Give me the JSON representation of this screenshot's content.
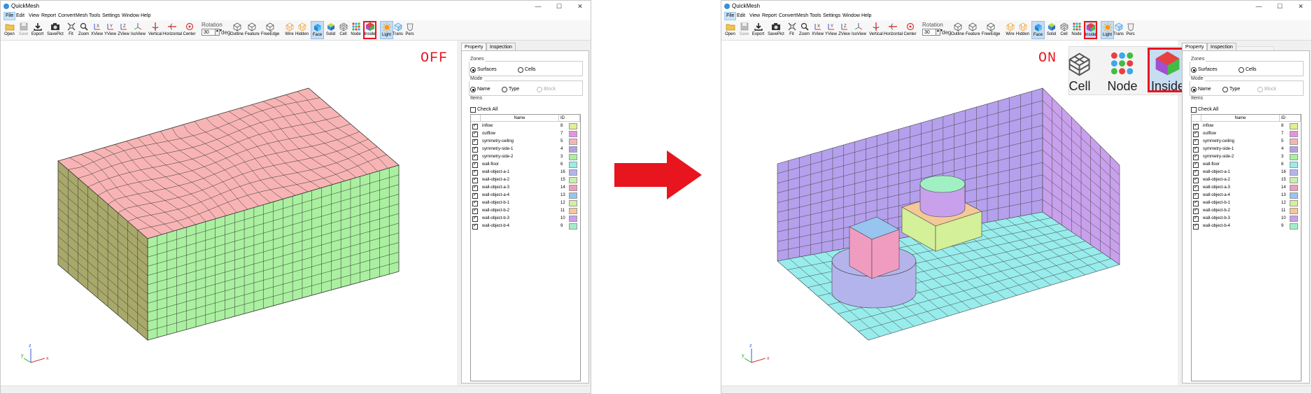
{
  "app": {
    "title": "QuickMesh",
    "minimize": "—",
    "maximize": "☐",
    "close": "✕"
  },
  "menu": [
    "File",
    "Edit",
    "View",
    "Report",
    "Convert",
    "Mesh",
    "Tools",
    "Settings",
    "Window",
    "Help"
  ],
  "toolbar": {
    "buttons": [
      {
        "id": "open",
        "label": "Open",
        "icon": "folder-icon"
      },
      {
        "id": "save",
        "label": "Save",
        "icon": "save-icon"
      },
      {
        "id": "export",
        "label": "Export",
        "icon": "export-icon"
      },
      {
        "id": "savepict",
        "label": "SavePict",
        "icon": "camera-icon"
      },
      {
        "id": "fit",
        "label": "Fit",
        "icon": "fit-icon"
      },
      {
        "id": "zoom",
        "label": "Zoom",
        "icon": "zoom-icon"
      },
      {
        "id": "xview",
        "label": "XView",
        "icon": "xview-icon"
      },
      {
        "id": "yview",
        "label": "YView",
        "icon": "yview-icon"
      },
      {
        "id": "zview",
        "label": "ZView",
        "icon": "zview-icon"
      },
      {
        "id": "isoview",
        "label": "IsoView",
        "icon": "isoview-icon"
      },
      {
        "id": "vertical",
        "label": "Vertical",
        "icon": "vertical-icon"
      },
      {
        "id": "horizontal",
        "label": "Horizontal",
        "icon": "horizontal-icon"
      },
      {
        "id": "center",
        "label": "Center",
        "icon": "center-icon"
      },
      {
        "id": "outline",
        "label": "Outline",
        "icon": "outline-icon"
      },
      {
        "id": "feature",
        "label": "Feature",
        "icon": "feature-icon"
      },
      {
        "id": "freeedge",
        "label": "FreeEdge",
        "icon": "freeedge-icon"
      },
      {
        "id": "wire",
        "label": "Wire",
        "icon": "wire-icon"
      },
      {
        "id": "hidden",
        "label": "Hidden",
        "icon": "hidden-icon"
      },
      {
        "id": "face",
        "label": "Face",
        "icon": "face-icon"
      },
      {
        "id": "solid",
        "label": "Solid",
        "icon": "solid-icon"
      },
      {
        "id": "cell",
        "label": "Cell",
        "icon": "cell-icon"
      },
      {
        "id": "node",
        "label": "Node",
        "icon": "node-icon"
      },
      {
        "id": "inside",
        "label": "Inside",
        "icon": "inside-icon"
      },
      {
        "id": "light",
        "label": "Light",
        "icon": "light-icon"
      },
      {
        "id": "trans",
        "label": "Trans",
        "icon": "trans-icon"
      },
      {
        "id": "pers",
        "label": "Pers",
        "icon": "pers-icon"
      }
    ],
    "rotation_label": "Rotation",
    "rotation_value": "30",
    "rotation_unit": "deg"
  },
  "panel": {
    "tabs": [
      "Property",
      "Inspection"
    ],
    "zones": {
      "title": "Zones",
      "options": [
        "Surfaces",
        "Cells"
      ],
      "selected": "Surfaces"
    },
    "mode": {
      "title": "Mode",
      "options": [
        "Name",
        "Type",
        "Block"
      ],
      "selected": "Name"
    },
    "items": {
      "title": "Items",
      "check_all": "Check All",
      "columns": [
        "Name",
        "ID"
      ],
      "rows": [
        {
          "name": "inflow",
          "id": "8",
          "color": "#e4ec96"
        },
        {
          "name": "outflow",
          "id": "7",
          "color": "#e294e2"
        },
        {
          "name": "symmetry-ceiling",
          "id": "5",
          "color": "#f8b4b4"
        },
        {
          "name": "symmetry-side-1",
          "id": "4",
          "color": "#b4a0ec"
        },
        {
          "name": "symmetry-side-2",
          "id": "3",
          "color": "#aaf0a0"
        },
        {
          "name": "wall-floor",
          "id": "6",
          "color": "#98ecec"
        },
        {
          "name": "wall-object-a-1",
          "id": "16",
          "color": "#b4b4ec"
        },
        {
          "name": "wall-object-a-2",
          "id": "15",
          "color": "#c8f0a8"
        },
        {
          "name": "wall-object-a-3",
          "id": "14",
          "color": "#f09cc0"
        },
        {
          "name": "wall-object-a-4",
          "id": "13",
          "color": "#98c4f0"
        },
        {
          "name": "wall-object-b-1",
          "id": "12",
          "color": "#d4f098"
        },
        {
          "name": "wall-object-b-2",
          "id": "11",
          "color": "#f4c898"
        },
        {
          "name": "wall-object-b-3",
          "id": "10",
          "color": "#c8a0ec"
        },
        {
          "name": "wall-object-b-4",
          "id": "9",
          "color": "#a0f0c4"
        }
      ]
    }
  },
  "status_left": "OFF",
  "status_right": "ON",
  "axes": {
    "x": "x",
    "y": "y",
    "z": "z"
  },
  "zoom_callout": [
    {
      "label": "Cell",
      "icon": "cell-icon"
    },
    {
      "label": "Node",
      "icon": "node-icon"
    },
    {
      "label": "Inside",
      "icon": "inside-icon"
    },
    {
      "label": "Light",
      "icon": "light-icon"
    },
    {
      "label": "Trar",
      "icon": "trans-icon"
    }
  ],
  "colors": {
    "top_face": "#f8b4b4",
    "front_face": "#aaf0a0",
    "side_face": "#a8a86a",
    "wall_back": "#b4a0ec",
    "wall_right": "#c8a0ec",
    "floor": "#98ecec",
    "highlight": "#e8141e",
    "arrow": "#e8141e",
    "pressed": "#c7ddf2"
  }
}
